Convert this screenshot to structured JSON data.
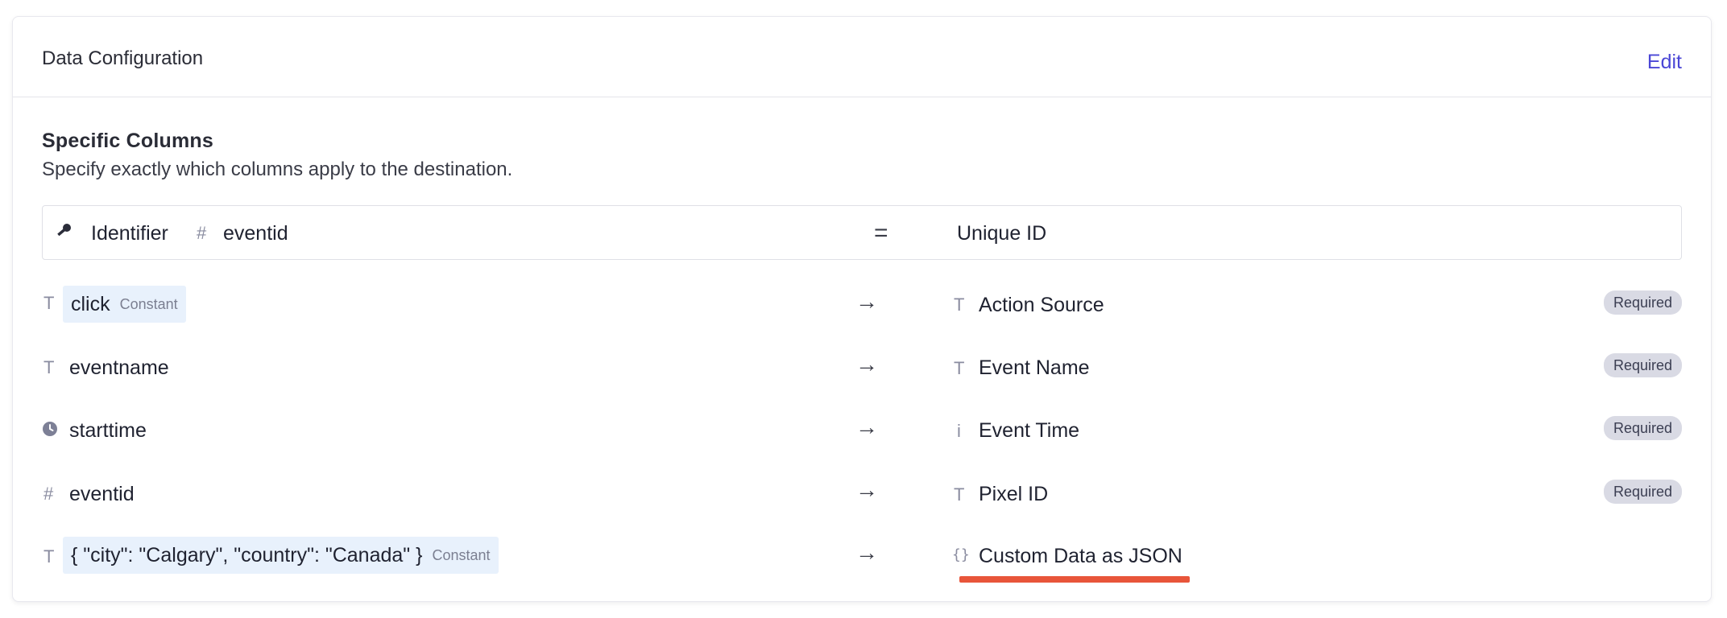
{
  "header": {
    "title": "Data Configuration",
    "edit_label": "Edit"
  },
  "section": {
    "title": "Specific Columns",
    "description": "Specify exactly which columns apply to the destination."
  },
  "identifier_row": {
    "label": "Identifier",
    "source_type_glyph": "#",
    "source": "eventid",
    "operator": "=",
    "target": "Unique ID"
  },
  "mappings": [
    {
      "source_type_glyph": "T",
      "source": "click",
      "is_constant": true,
      "constant_label": "Constant",
      "arrow": "→",
      "target_type_glyph": "T",
      "target": "Action Source",
      "badge": "Required"
    },
    {
      "source_type_glyph": "T",
      "source": "eventname",
      "arrow": "→",
      "target_type_glyph": "T",
      "target": "Event Name",
      "badge": "Required"
    },
    {
      "source_type_glyph": "clock-icon",
      "source": "starttime",
      "arrow": "→",
      "target_type_glyph": "i",
      "target": "Event Time",
      "badge": "Required"
    },
    {
      "source_type_glyph": "#",
      "source": "eventid",
      "arrow": "→",
      "target_type_glyph": "T",
      "target": "Pixel ID",
      "badge": "Required"
    },
    {
      "source_type_glyph": "T",
      "source": "{ \"city\": \"Calgary\", \"country\": \"Canada\" }",
      "is_constant": true,
      "constant_label": "Constant",
      "arrow": "→",
      "target_type_glyph": "{}",
      "target": "Custom Data as JSON"
    }
  ],
  "colors": {
    "accent": "#4b47d6",
    "highlight": "#e8553a",
    "constant_bg": "#e8f1fc",
    "badge_bg": "#d9dae4"
  }
}
